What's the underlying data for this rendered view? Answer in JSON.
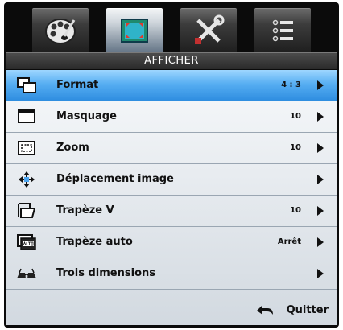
{
  "tabs": [
    {
      "name": "palette-icon",
      "active": false
    },
    {
      "name": "display-icon",
      "active": true
    },
    {
      "name": "tools-icon",
      "active": false
    },
    {
      "name": "list-icon",
      "active": false
    }
  ],
  "header": {
    "title": "AFFICHER"
  },
  "menu": {
    "items": [
      {
        "label": "Format",
        "value": "4 : 3",
        "icon": "format-icon",
        "selected": true
      },
      {
        "label": "Masquage",
        "value": "10",
        "icon": "masking-icon"
      },
      {
        "label": "Zoom",
        "value": "10",
        "icon": "zoom-icon"
      },
      {
        "label": "Déplacement image",
        "value": "",
        "icon": "move-arrows-icon"
      },
      {
        "label": "Trapèze V",
        "value": "10",
        "icon": "keystone-icon"
      },
      {
        "label": "Trapèze auto",
        "value": "Arrêt",
        "icon": "auto-keystone-icon"
      },
      {
        "label": "Trois dimensions",
        "value": "",
        "icon": "3d-glasses-icon"
      }
    ]
  },
  "footer": {
    "quit_label": "Quitter",
    "back_icon": "back-arrow-icon"
  },
  "colors": {
    "selected_row": "#4aa3ee",
    "menu_bg": "#e8edf2",
    "osd_bg": "#0b0b0b"
  }
}
